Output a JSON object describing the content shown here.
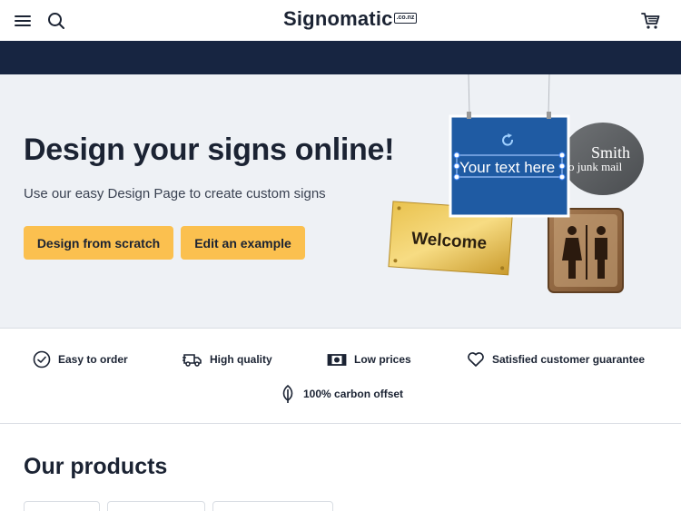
{
  "header": {
    "menu_icon": "hamburger-menu-icon",
    "search_icon": "search-icon",
    "logo_text": "Signomatic",
    "logo_tag": ".co.nz",
    "cart_icon": "shopping-cart-icon"
  },
  "hero": {
    "title": "Design your signs online!",
    "subtitle": "Use our easy Design Page to create custom signs",
    "primary_button": "Design from scratch",
    "secondary_button": "Edit an example",
    "art": {
      "editor_sign_text": "Your text here",
      "welcome_sign_text": "Welcome",
      "oval_sign_line1": "Smith",
      "oval_sign_line2": "o junk mail"
    }
  },
  "features": [
    {
      "icon": "check-circle-icon",
      "label": "Easy to order"
    },
    {
      "icon": "delivery-truck-icon",
      "label": "High quality"
    },
    {
      "icon": "cash-icon",
      "label": "Low prices"
    },
    {
      "icon": "heart-icon",
      "label": "Satisfied customer guarantee"
    },
    {
      "icon": "leaf-icon",
      "label": "100% carbon offset"
    }
  ],
  "products": {
    "title": "Our products"
  },
  "colors": {
    "navy": "#172541",
    "accent": "#fbc04f",
    "hero_bg": "#eef1f5"
  }
}
